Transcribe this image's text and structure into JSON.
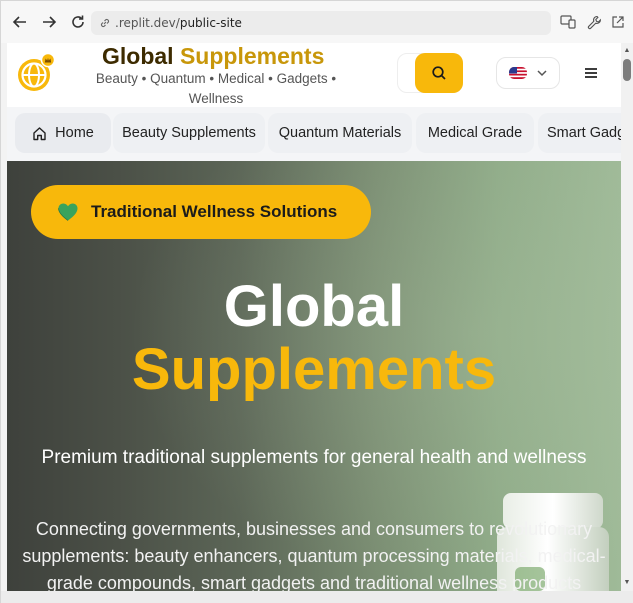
{
  "browser": {
    "url_prefix": ".replit.dev/",
    "url_path": "public-site"
  },
  "site": {
    "brand_part1": "Global",
    "brand_part2": "Supplements",
    "subtitle": "Beauty • Quantum • Medical • Gadgets • Wellness",
    "colors": {
      "accent": "#f8b80b",
      "brand_dark": "#3d2b00"
    }
  },
  "categories": [
    {
      "label": "Home",
      "icon": "home-icon"
    },
    {
      "label": "Beauty Supplements"
    },
    {
      "label": "Quantum Materials"
    },
    {
      "label": "Medical Grade"
    },
    {
      "label": "Smart Gadg"
    }
  ],
  "hero": {
    "badge": "Traditional Wellness Solutions",
    "badge_icon": "green-heart-icon",
    "title_line1": "Global",
    "title_line2": "Supplements",
    "tagline": "Premium traditional supplements for general health and wellness",
    "description": "Connecting governments, businesses and consumers to revolutionary supplements: beauty enhancers, quantum processing materials, medical-grade compounds, smart gadgets and traditional wellness products"
  }
}
